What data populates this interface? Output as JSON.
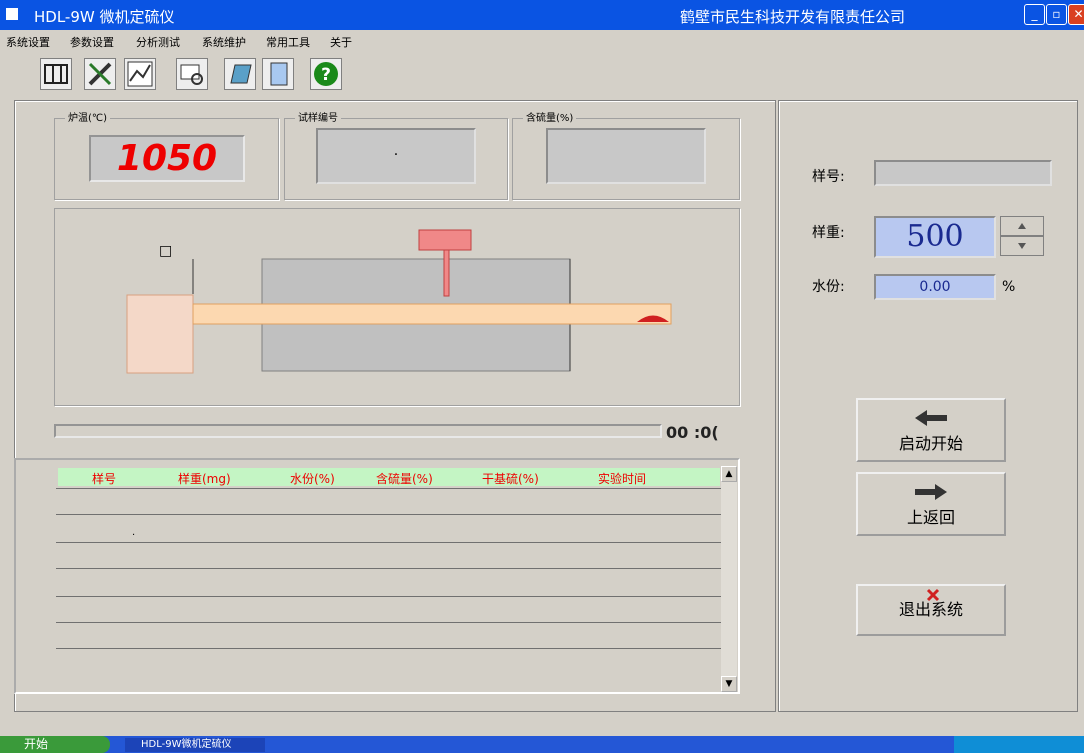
{
  "window": {
    "title": "HDL-9W 微机定硫仪",
    "company": "鹤壁市民生科技开发有限责任公司",
    "minimize_glyph": "_",
    "restore_glyph": "▫",
    "close_glyph": "✕"
  },
  "menu": [
    "系统设置",
    "参数设置",
    "分析测试",
    "系统维护",
    "常用工具",
    "关于"
  ],
  "toolbar": {
    "icons": [
      "grid-icon",
      "tools-icon",
      "chart-icon",
      "search-icon",
      "notebook-icon",
      "document-icon",
      "help-icon"
    ]
  },
  "groups": {
    "furnace_temp_label": "炉温(℃)",
    "temp_value": "1050",
    "box2_label": "试样编号",
    "box2_value": "·",
    "box3_label": "含硫量(%)",
    "box3_value": ""
  },
  "diagram": {
    "mark": "□"
  },
  "progress": {
    "time": "00 :0("
  },
  "right_panel": {
    "sample_label": "样号:",
    "sample_value": "",
    "weight_label": "样重:",
    "weight_value": "500",
    "moisture_label": "水份:",
    "moisture_value": "0.00",
    "moisture_unit": "%"
  },
  "buttons": {
    "start": "启动开始",
    "back": "上返回",
    "exit": "退出系统"
  },
  "table": {
    "headers": [
      "样号",
      "样重(mg)",
      "水份(%)",
      "含硫量(%)",
      "干基硫(%)",
      "实验时间"
    ],
    "row_count": 8,
    "first_cell": "·"
  },
  "taskbar": {
    "start_label": "开始",
    "task_label": "HDL-9W微机定硫仪"
  }
}
